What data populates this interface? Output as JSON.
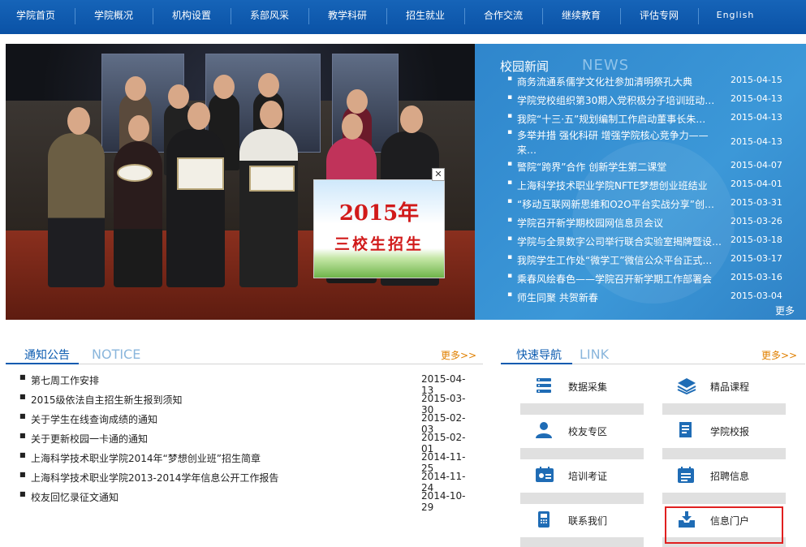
{
  "nav": {
    "items": [
      {
        "label": "学院首页"
      },
      {
        "label": "学院概况"
      },
      {
        "label": "机构设置"
      },
      {
        "label": "系部风采"
      },
      {
        "label": "教学科研"
      },
      {
        "label": "招生就业"
      },
      {
        "label": "合作交流"
      },
      {
        "label": "继续教育"
      },
      {
        "label": "评估专网"
      },
      {
        "label": "English"
      }
    ]
  },
  "banner": {
    "popup_line1": "2015年",
    "popup_line2": "三校生招生",
    "close_glyph": "✕"
  },
  "news": {
    "title": "校园新闻",
    "title_en": "NEWS",
    "more": "更多>>",
    "items": [
      {
        "title": "商务流通系儒学文化社参加清明祭孔大典",
        "date": "2015-04-15"
      },
      {
        "title": "学院党校组织第30期入党积极分子培训班动员…",
        "date": "2015-04-13"
      },
      {
        "title": "我院“十三·五”规划编制工作启动董事长朱…",
        "date": "2015-04-13"
      },
      {
        "title": "多举并措 强化科研 增强学院核心竞争力——来…",
        "date": "2015-04-13"
      },
      {
        "title": "警院“跨界”合作 创新学生第二课堂",
        "date": "2015-04-07"
      },
      {
        "title": "上海科学技术职业学院NFTE梦想创业班结业",
        "date": "2015-04-01"
      },
      {
        "title": "“移动互联网新思维和O2O平台实战分享”创…",
        "date": "2015-03-31"
      },
      {
        "title": "学院召开新学期校园网信息员会议",
        "date": "2015-03-26"
      },
      {
        "title": "学院与全景数字公司举行联合实验室揭牌暨设…",
        "date": "2015-03-18"
      },
      {
        "title": "我院学生工作处“微学工”微信公众平台正式…",
        "date": "2015-03-17"
      },
      {
        "title": "乘春风绘春色——学院召开新学期工作部署会",
        "date": "2015-03-16"
      },
      {
        "title": "师生同聚 共贺新春",
        "date": "2015-03-04"
      }
    ]
  },
  "notice": {
    "title": "通知公告",
    "title_en": "NOTICE",
    "more": "更多>>",
    "items": [
      {
        "title": "第七周工作安排",
        "date": "2015-04-13"
      },
      {
        "title": "2015级依法自主招生新生报到须知",
        "date": "2015-03-30"
      },
      {
        "title": "关于学生在线查询成绩的通知",
        "date": "2015-02-03"
      },
      {
        "title": "关于更新校园一卡通的通知",
        "date": "2015-02-01"
      },
      {
        "title": "上海科学技术职业学院2014年“梦想创业班”招生简章",
        "date": "2014-11-25"
      },
      {
        "title": "上海科学技术职业学院2013-2014学年信息公开工作报告",
        "date": "2014-11-24"
      },
      {
        "title": "校友回忆录征文通知",
        "date": "2014-10-29"
      }
    ]
  },
  "quicklinks": {
    "title": "快速导航",
    "title_en": "LINK",
    "more": "更多>>",
    "items": [
      {
        "label": "数据采集",
        "icon": "database-icon"
      },
      {
        "label": "精品课程",
        "icon": "layers-icon"
      },
      {
        "label": "校友专区",
        "icon": "user-icon"
      },
      {
        "label": "学院校报",
        "icon": "newspaper-icon"
      },
      {
        "label": "培训考证",
        "icon": "id-card-icon"
      },
      {
        "label": "招聘信息",
        "icon": "calendar-list-icon"
      },
      {
        "label": "联系我们",
        "icon": "phone-icon"
      },
      {
        "label": "信息门户",
        "icon": "inbox-download-icon"
      }
    ]
  },
  "colors": {
    "nav_bg": "#0a52a6",
    "news_bg": "#3c98d8",
    "title_blue": "#0b5bb0",
    "more_orange": "#e08000",
    "popup_red": "#d11a1a",
    "highlight_red": "#e02020"
  }
}
